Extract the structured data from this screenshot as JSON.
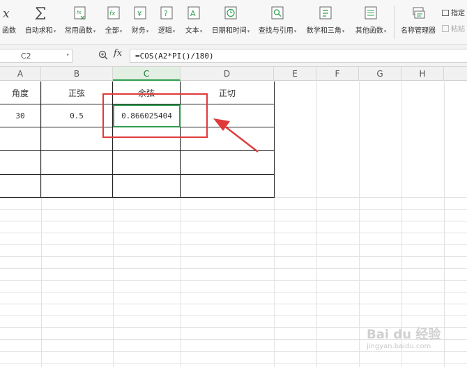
{
  "ribbon": {
    "buttons": [
      {
        "id": "insert-function",
        "label": "函数",
        "icon": "fx-icon",
        "caret": false
      },
      {
        "id": "autosum",
        "label": "自动求和",
        "icon": "sigma-icon",
        "caret": true
      },
      {
        "id": "common-functions",
        "label": "常用函数",
        "icon": "fx-star-icon",
        "caret": true
      },
      {
        "id": "all-functions",
        "label": "全部",
        "icon": "fx-box-icon",
        "caret": true
      },
      {
        "id": "financial",
        "label": "财务",
        "icon": "yen-icon",
        "caret": true
      },
      {
        "id": "logical",
        "label": "逻辑",
        "icon": "question-icon",
        "caret": true
      },
      {
        "id": "text",
        "label": "文本",
        "icon": "text-a-icon",
        "caret": true
      },
      {
        "id": "datetime",
        "label": "日期和时间",
        "icon": "clock-icon",
        "caret": true
      },
      {
        "id": "lookup",
        "label": "查找与引用",
        "icon": "lookup-icon",
        "caret": true
      },
      {
        "id": "math-trig",
        "label": "数学和三角",
        "icon": "math-icon",
        "caret": true
      },
      {
        "id": "other-functions",
        "label": "其他函数",
        "icon": "more-icon",
        "caret": true
      },
      {
        "id": "name-manager",
        "label": "名称管理器",
        "icon": "name-manager-icon",
        "caret": false
      }
    ],
    "side_top": "指定",
    "side_bottom": "粘贴"
  },
  "formula_bar": {
    "name_box": "C2",
    "fx": "fx",
    "formula": "=COS(A2*PI()/180)"
  },
  "columns": [
    "A",
    "B",
    "C",
    "D",
    "E",
    "F",
    "G",
    "H"
  ],
  "selected_column": "C",
  "table": {
    "headers": [
      "角度",
      "正弦",
      "余弦",
      "正切"
    ],
    "row": [
      "30",
      "0.5",
      "0.866025404",
      ""
    ]
  },
  "watermark": {
    "line1": "Bai du 经验",
    "line2": "jingyan.baidu.com"
  },
  "colors": {
    "accent_green": "#2e9e4e",
    "annotation_red": "#e03a3a"
  }
}
